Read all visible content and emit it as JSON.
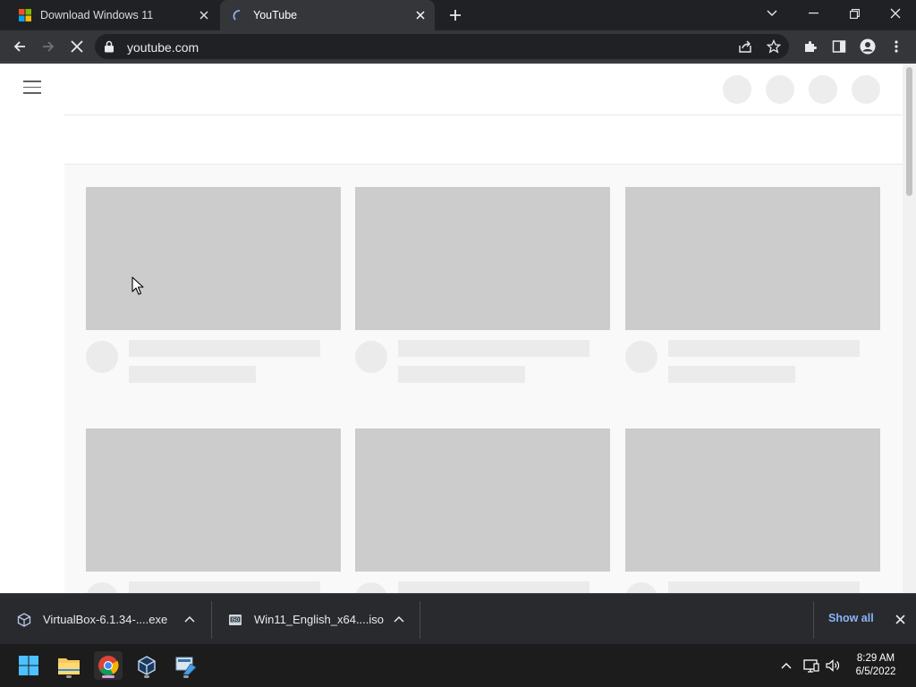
{
  "tabs": [
    {
      "title": "Download Windows 11",
      "active": false,
      "icon": "microsoft-logo-icon"
    },
    {
      "title": "YouTube",
      "active": true,
      "icon": "loading-spinner-icon"
    }
  ],
  "toolbar": {
    "url": "youtube.com",
    "icons": [
      "back-arrow-icon",
      "forward-arrow-icon",
      "stop-loading-icon",
      "lock-icon",
      "share-icon",
      "star-icon",
      "puzzle-extensions-icon",
      "side-panel-icon",
      "profile-icon",
      "kebab-menu-icon"
    ]
  },
  "page": {
    "state": "loading-skeleton",
    "rows": 2,
    "columns": 3
  },
  "downloads": {
    "items": [
      {
        "filename": "VirtualBox-6.1.34-....exe",
        "icon": "virtualbox-icon"
      },
      {
        "filename": "Win11_English_x64....iso",
        "icon": "iso-disc-icon"
      }
    ],
    "show_all": "Show all"
  },
  "taskbar": {
    "apps": [
      "windows-start-icon",
      "file-explorer-icon",
      "chrome-icon",
      "virtualbox-icon",
      "setup-icon"
    ],
    "time": "8:29 AM",
    "date": "6/5/2022"
  },
  "colors": {
    "accent": "#8ab4f8",
    "chrome_dark": "#202124",
    "toolbar": "#35363a",
    "skeleton": "#cccccc"
  }
}
